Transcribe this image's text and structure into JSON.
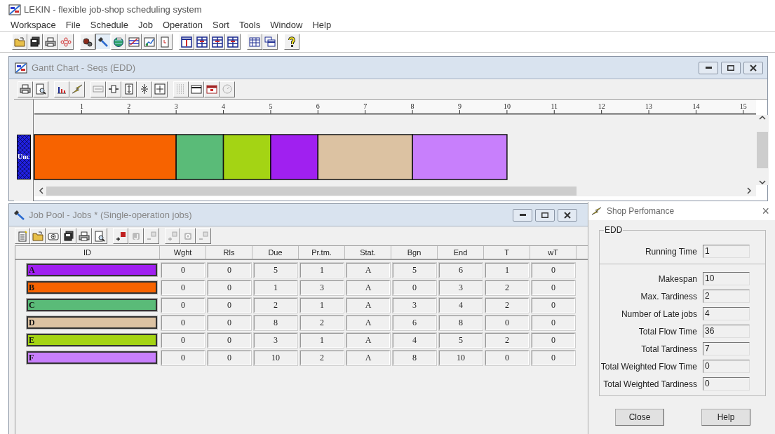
{
  "app": {
    "title": "LEKIN - flexible job-shop scheduling system"
  },
  "menu": [
    "Workspace",
    "File",
    "Schedule",
    "Job",
    "Operation",
    "Sort",
    "Tools",
    "Window",
    "Help"
  ],
  "main_toolbar": [
    {
      "pressed": false
    },
    {
      "pressed": false
    },
    {
      "pressed": false
    },
    {
      "pressed": false
    },
    {
      "pressed": false
    },
    {
      "pressed": true
    },
    {
      "pressed": false
    },
    {
      "pressed": false
    },
    {
      "pressed": false
    },
    {
      "pressed": false
    },
    {
      "pressed": false
    },
    {
      "pressed": false
    },
    {
      "pressed": false
    },
    {
      "pressed": false
    },
    {
      "pressed": false
    },
    {
      "pressed": false
    },
    {
      "pressed": false
    }
  ],
  "gantt_window": {
    "title": "Gantt Chart - Seqs (EDD)",
    "chart_data": {
      "type": "bar",
      "orientation": "horizontal",
      "stacked": true,
      "categories": [
        "Unc"
      ],
      "xlim": [
        0,
        15.24
      ],
      "xticks": [
        1,
        2,
        3,
        4,
        5,
        6,
        7,
        8,
        9,
        10,
        11,
        12,
        13,
        14,
        15
      ],
      "series": [
        {
          "color": "#f76300",
          "values": [
            3
          ]
        },
        {
          "color": "#5abb78",
          "values": [
            1
          ]
        },
        {
          "color": "#a4d414",
          "values": [
            1
          ]
        },
        {
          "color": "#a020f0",
          "values": [
            1
          ]
        },
        {
          "color": "#dcc2a2",
          "values": [
            2
          ]
        },
        {
          "color": "#c87ffc",
          "values": [
            2
          ]
        }
      ]
    }
  },
  "job_pool_window": {
    "title": "Job Pool - Jobs * (Single-operation jobs)",
    "table": {
      "columns": [
        "ID",
        "Wght",
        "Rls",
        "Due",
        "Pr.tm.",
        "Stat.",
        "Bgn",
        "End",
        "T",
        "wT"
      ],
      "rows": [
        {
          "color": "#a020f0",
          "cells": [
            "A",
            "0",
            "0",
            "5",
            "1",
            "A",
            "5",
            "6",
            "1",
            "0"
          ]
        },
        {
          "color": "#f76300",
          "cells": [
            "B",
            "0",
            "0",
            "1",
            "3",
            "A",
            "0",
            "3",
            "2",
            "0"
          ]
        },
        {
          "color": "#5abb78",
          "cells": [
            "C",
            "0",
            "0",
            "2",
            "1",
            "A",
            "3",
            "4",
            "2",
            "0"
          ]
        },
        {
          "color": "#dcc2a2",
          "cells": [
            "D",
            "0",
            "0",
            "8",
            "2",
            "A",
            "6",
            "8",
            "0",
            "0"
          ]
        },
        {
          "color": "#a4d414",
          "cells": [
            "E",
            "0",
            "0",
            "3",
            "1",
            "A",
            "4",
            "5",
            "2",
            "0"
          ]
        },
        {
          "color": "#c87ffc",
          "cells": [
            "F",
            "0",
            "0",
            "10",
            "2",
            "A",
            "8",
            "10",
            "0",
            "0"
          ]
        }
      ]
    }
  },
  "shop_performance": {
    "title": "Shop Perfomance",
    "close": "×",
    "group_label": "EDD",
    "running_time": {
      "label": "Running Time",
      "value": "1"
    },
    "metrics": [
      {
        "label": "Makespan",
        "value": "10"
      },
      {
        "label": "Max. Tardiness",
        "value": "2"
      },
      {
        "label": "Number of Late jobs",
        "value": "4"
      },
      {
        "label": "Total Flow Time",
        "value": "36"
      },
      {
        "label": "Total Tardiness",
        "value": "7"
      },
      {
        "label": "Total Weighted Flow Time",
        "value": "0"
      },
      {
        "label": "Total Weighted Tardiness",
        "value": "0"
      }
    ],
    "buttons": [
      "Close",
      "Help"
    ]
  }
}
